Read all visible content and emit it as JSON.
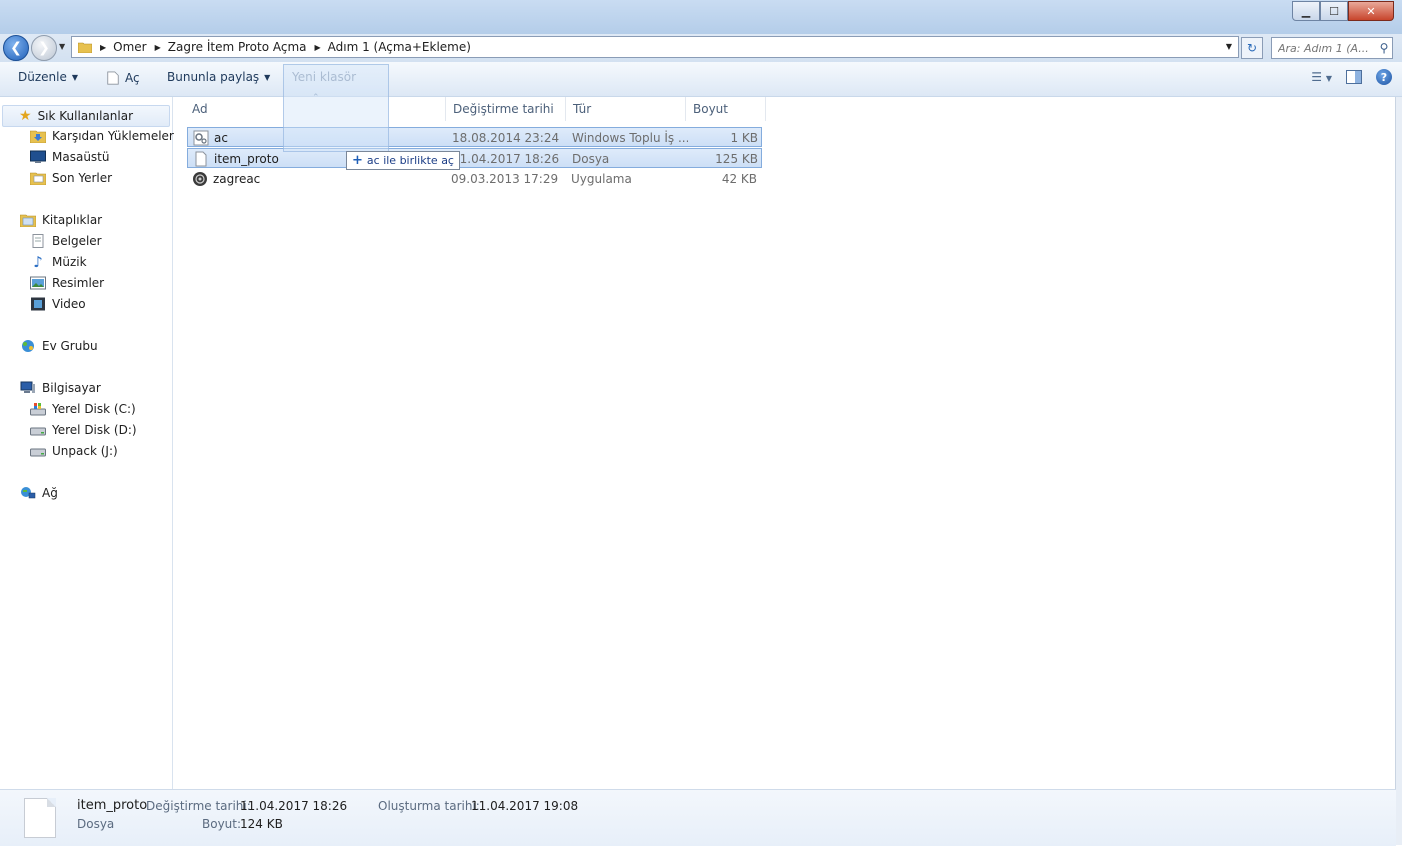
{
  "window": {
    "buttons": {
      "minimize": "▁",
      "maximize": "☐",
      "close": "✕"
    }
  },
  "address": {
    "breadcrumbs": [
      "Omer",
      "Zagre İtem Proto Açma",
      "Adım 1 (Açma+Ekleme)"
    ],
    "search_placeholder": "Ara: Adım 1 (A..."
  },
  "toolbar": {
    "organize": "Düzenle",
    "open": "Aç",
    "share": "Bununla paylaş",
    "new_folder": "Yeni klasör"
  },
  "sidebar": {
    "favorites": {
      "label": "Sık Kullanılanlar",
      "items": [
        "Karşıdan Yüklemeler",
        "Masaüstü",
        "Son Yerler"
      ]
    },
    "libraries": {
      "label": "Kitaplıklar",
      "items": [
        "Belgeler",
        "Müzik",
        "Resimler",
        "Video"
      ]
    },
    "homegroup": {
      "label": "Ev Grubu"
    },
    "computer": {
      "label": "Bilgisayar",
      "items": [
        "Yerel Disk (C:)",
        "Yerel Disk (D:)",
        "Unpack (J:)"
      ]
    },
    "network": {
      "label": "Ağ"
    }
  },
  "columns": {
    "name": "Ad",
    "modified": "Değiştirme tarihi",
    "type": "Tür",
    "size": "Boyut"
  },
  "files": [
    {
      "name": "ac",
      "modified": "18.08.2014 23:24",
      "type": "Windows Toplu İş ...",
      "size": "1 KB",
      "icon": "batch-file-icon",
      "selected": true
    },
    {
      "name": "item_proto",
      "modified": "11.04.2017 18:26",
      "type": "Dosya",
      "size": "125 KB",
      "icon": "blank-file-icon",
      "selected": true
    },
    {
      "name": "zagreac",
      "modified": "09.03.2013 17:29",
      "type": "Uygulama",
      "size": "42 KB",
      "icon": "application-icon",
      "selected": false
    }
  ],
  "drag_tooltip": "ac ile birlikte aç",
  "details": {
    "name": "item_proto",
    "type": "Dosya",
    "modified_label": "Değiştirme tarihi:",
    "modified_value": "11.04.2017 18:26",
    "size_label": "Boyut:",
    "size_value": "124 KB",
    "created_label": "Oluşturma tarihi:",
    "created_value": "11.04.2017 19:08"
  },
  "colors": {
    "selection_bg": "#cddff6",
    "selection_border": "#84acdd",
    "link_text": "#1e395b"
  }
}
